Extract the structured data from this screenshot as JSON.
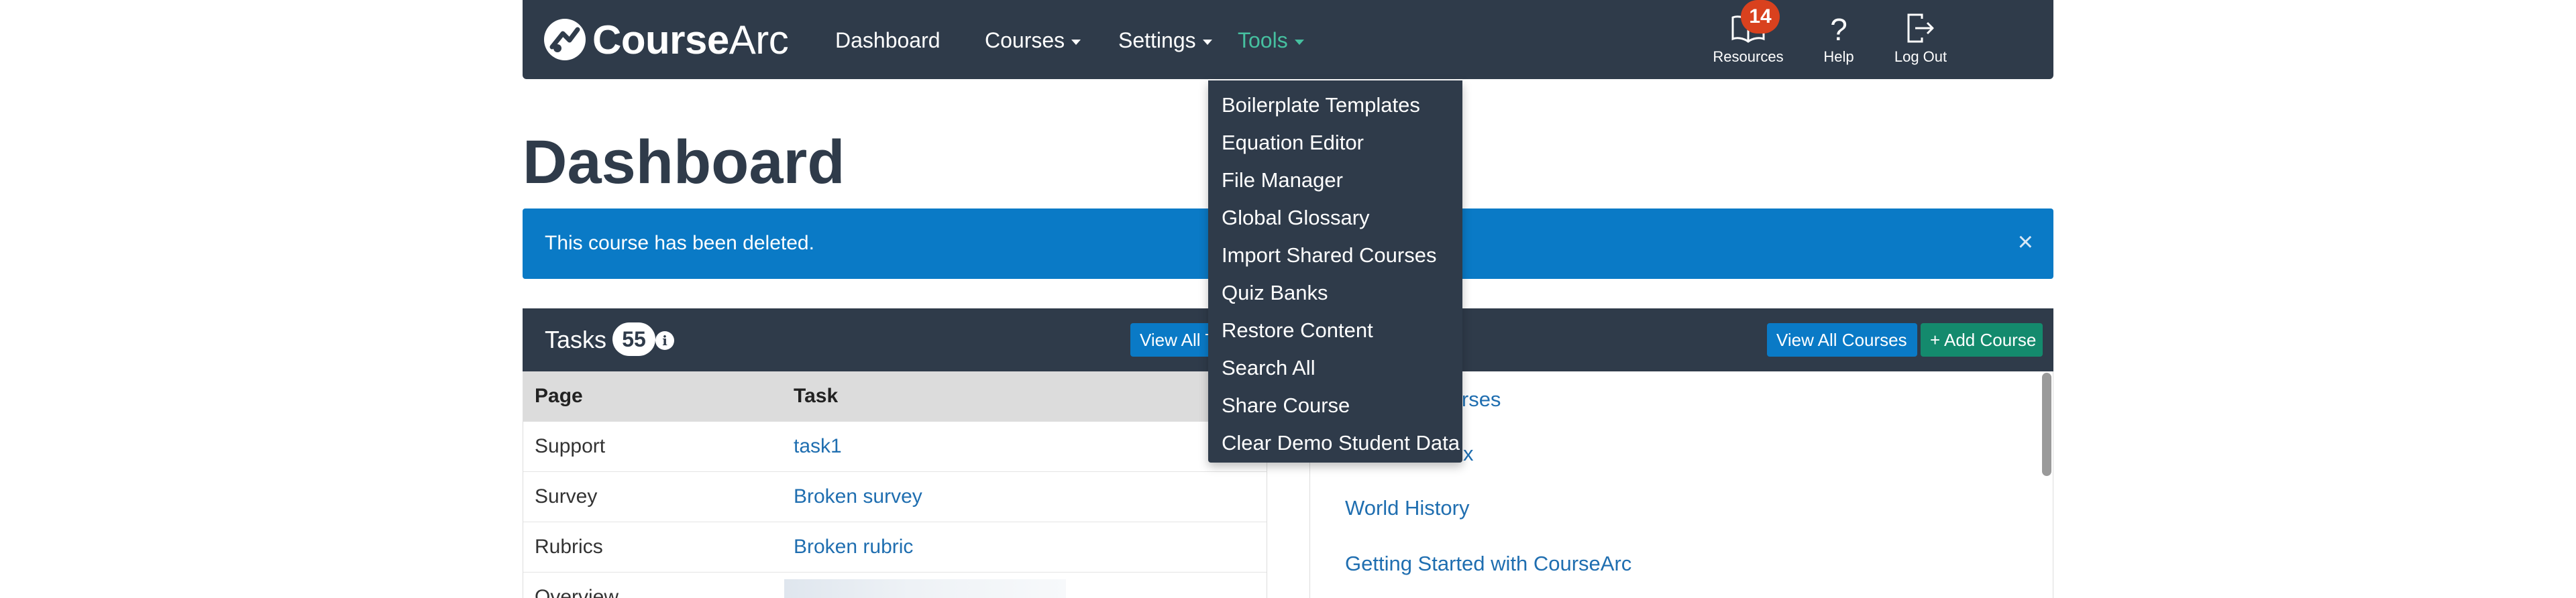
{
  "navbar": {
    "brand": {
      "part1": "Course",
      "part2": "Arc"
    },
    "links": [
      {
        "label": "Dashboard"
      },
      {
        "label": "Courses"
      },
      {
        "label": "Settings"
      },
      {
        "label": "Tools"
      }
    ],
    "utilities": [
      {
        "label": "Resources",
        "icon": "book-icon"
      },
      {
        "label": "Help",
        "icon": "question-icon"
      },
      {
        "label": "Log Out",
        "icon": "logout-icon"
      }
    ],
    "notification_count": "14",
    "colors": {
      "bar": "#2f3b4a",
      "active_link": "#46c0a0",
      "badge": "#d9411e"
    }
  },
  "page": {
    "title": "Dashboard"
  },
  "alert": {
    "text": "This course has been deleted.",
    "close": "×",
    "color": "#0a7ac6"
  },
  "tasks_panel": {
    "title": "Tasks",
    "count": "55",
    "info": "i",
    "view_all_label": "View All Tasks",
    "columns": [
      "Page",
      "Task"
    ],
    "rows": [
      {
        "page": "Support",
        "task": "task1"
      },
      {
        "page": "Survey",
        "task": "Broken survey"
      },
      {
        "page": "Rubrics",
        "task": "Broken rubric"
      },
      {
        "page": "Overview",
        "task": ""
      }
    ]
  },
  "courses_panel": {
    "view_all_label": "View All Courses",
    "add_label": "+ Add Course",
    "courses": [
      "Courses",
      "x",
      "World History",
      "Getting Started with CourseArc"
    ]
  },
  "tools_menu": {
    "items": [
      "Boilerplate Templates",
      "Equation Editor",
      "File Manager",
      "Global Glossary",
      "Import Shared Courses",
      "Quiz Banks",
      "Restore Content",
      "Search All",
      "Share Course",
      "Clear Demo Student Data"
    ]
  }
}
